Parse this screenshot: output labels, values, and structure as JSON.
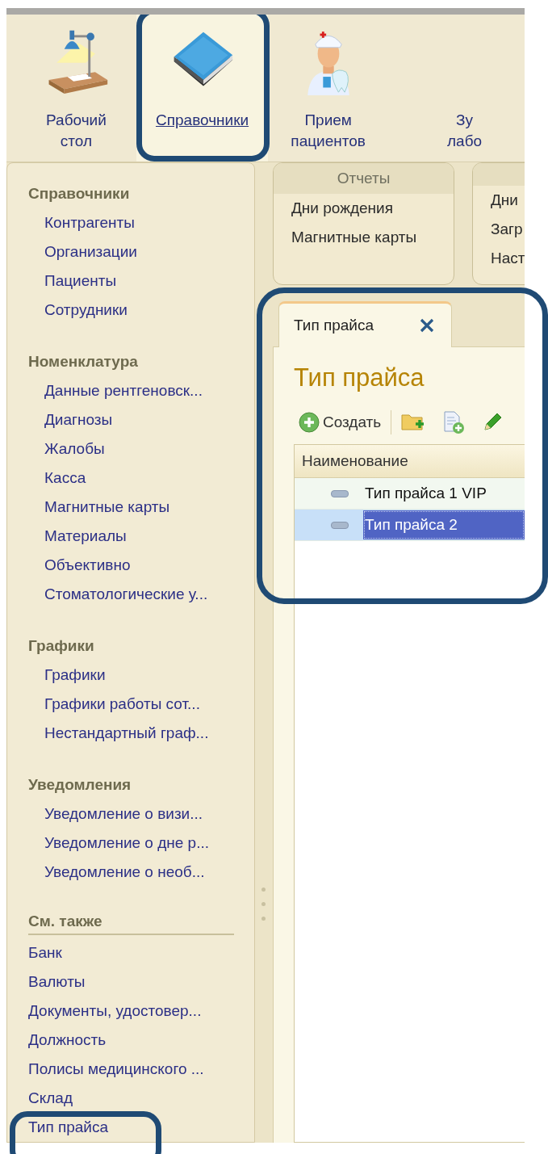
{
  "nav_sections": [
    {
      "kind": "desk",
      "lines": [
        "Рабочий",
        "стол"
      ],
      "selected": false,
      "highlighted": false
    },
    {
      "kind": "book",
      "lines": [
        "Справочники"
      ],
      "selected": true,
      "highlighted": true
    },
    {
      "kind": "doctor",
      "lines": [
        "Прием",
        "пациентов"
      ],
      "selected": false,
      "highlighted": false
    },
    {
      "kind": "none",
      "lines": [
        "Зу",
        "лабо"
      ],
      "selected": false,
      "highlighted": false
    }
  ],
  "sidebar": {
    "groups": [
      {
        "kind": "main",
        "heading": "Справочники",
        "items": [
          {
            "label": "Контрагенты",
            "highlighted": false
          },
          {
            "label": "Организации",
            "highlighted": false
          },
          {
            "label": "Пациенты",
            "highlighted": false
          },
          {
            "label": "Сотрудники",
            "highlighted": false
          }
        ]
      },
      {
        "kind": "main",
        "heading": "Номенклатура",
        "items": [
          {
            "label": "Данные рентгеновск...",
            "highlighted": false
          },
          {
            "label": "Диагнозы",
            "highlighted": false
          },
          {
            "label": "Жалобы",
            "highlighted": false
          },
          {
            "label": "Касса",
            "highlighted": false
          },
          {
            "label": "Магнитные карты",
            "highlighted": false
          },
          {
            "label": "Материалы",
            "highlighted": false
          },
          {
            "label": "Объективно",
            "highlighted": false
          },
          {
            "label": "Стоматологические у...",
            "highlighted": false
          }
        ]
      },
      {
        "kind": "main",
        "heading": "Графики",
        "items": [
          {
            "label": "Графики",
            "highlighted": false
          },
          {
            "label": "Графики работы сот...",
            "highlighted": false
          },
          {
            "label": "Нестандартный граф...",
            "highlighted": false
          }
        ]
      },
      {
        "kind": "main",
        "heading": "Уведомления",
        "items": [
          {
            "label": "Уведомление о визи...",
            "highlighted": false
          },
          {
            "label": "Уведомление о дне р...",
            "highlighted": false
          },
          {
            "label": "Уведомление о необ...",
            "highlighted": false
          }
        ]
      },
      {
        "kind": "see_also",
        "heading": "См. также",
        "items": [
          {
            "label": "Банк",
            "highlighted": false
          },
          {
            "label": "Валюты",
            "highlighted": false
          },
          {
            "label": "Документы, удостовер...",
            "highlighted": false
          },
          {
            "label": "Должность",
            "highlighted": false
          },
          {
            "label": "Полисы медицинского ...",
            "highlighted": false
          },
          {
            "label": "Склад",
            "highlighted": false
          },
          {
            "label": "Тип прайса",
            "highlighted": true
          }
        ]
      }
    ]
  },
  "report_panels": [
    {
      "title": "Отчеты",
      "items": [
        "Дни рождения",
        "Магнитные карты"
      ]
    },
    {
      "items": [
        "Дни",
        "Загр",
        "Наст"
      ]
    }
  ],
  "form": {
    "highlighted": true,
    "tab": {
      "label": "Тип прайса",
      "selected": true
    },
    "title": "Тип прайса",
    "create_button": "Создать",
    "table": {
      "columns": [
        "Наименование"
      ],
      "rows": [
        {
          "name": "Тип прайса 1 VIP",
          "selected": false
        },
        {
          "name": "Тип прайса 2",
          "selected": true
        }
      ]
    }
  }
}
